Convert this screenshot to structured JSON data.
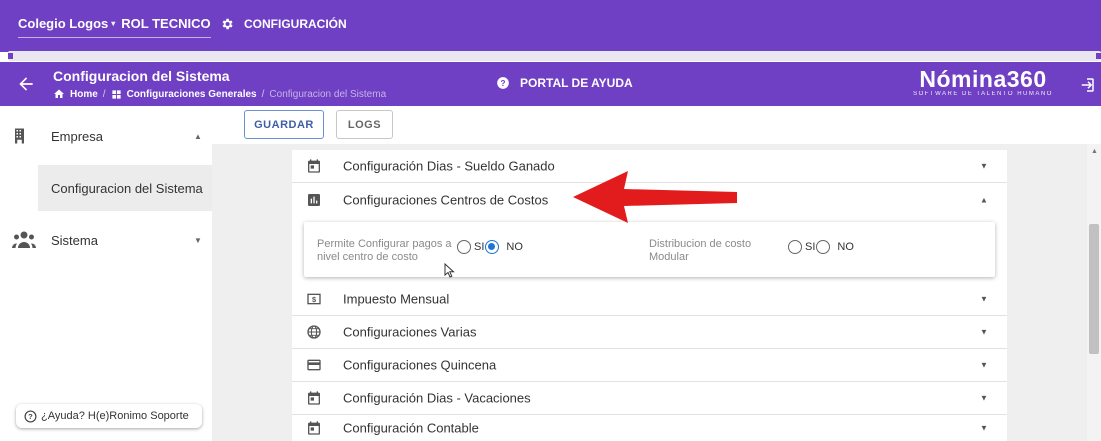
{
  "topbar": {
    "org_name": "Colegio Logos",
    "role": "ROL TECNICO",
    "config_label": "CONFIGURACIÓN"
  },
  "header": {
    "title": "Configuracion del Sistema",
    "breadcrumb": {
      "home": "Home",
      "general": "Configuraciones Generales",
      "current": "Configuracion del Sistema"
    },
    "help_portal": "PORTAL DE AYUDA",
    "brand_name": "Nómina360",
    "brand_tagline": "SOFTWARE DE TALENTO HUMANO"
  },
  "sidebar": {
    "items": [
      {
        "label": "Empresa",
        "icon": "building-icon"
      },
      {
        "label": "Configuracion del Sistema"
      },
      {
        "label": "Sistema",
        "icon": "group-icon"
      }
    ],
    "help_button": "¿Ayuda? H(e)Ronimo Soporte"
  },
  "toolbar": {
    "save_label": "GUARDAR",
    "logs_label": "LOGS"
  },
  "sections": [
    {
      "label": "Configuración Dias - Sueldo Ganado",
      "icon": "calendar-icon"
    },
    {
      "label": "Configuraciones Centros de Costos",
      "icon": "chart-icon"
    },
    {
      "label": "Impuesto Mensual",
      "icon": "money-icon"
    },
    {
      "label": "Configuraciones Varias",
      "icon": "globe-icon"
    },
    {
      "label": "Configuraciones Quincena",
      "icon": "card-icon"
    },
    {
      "label": "Configuración Dias - Vacaciones",
      "icon": "calendar-icon"
    },
    {
      "label": "Configuración Contable",
      "icon": "calendar-icon"
    }
  ],
  "cost_center_options": {
    "option1_label": "Permite Configurar pagos a nivel centro de costo",
    "option1_selected": "NO",
    "option2_label": "Distribucion de costo Modular",
    "option2_selected": "",
    "yes": "SI",
    "no": "NO"
  },
  "colors": {
    "primary": "#6f3fc4",
    "accent_blue": "#1e73d6",
    "arrow_red": "#e21c1c"
  }
}
